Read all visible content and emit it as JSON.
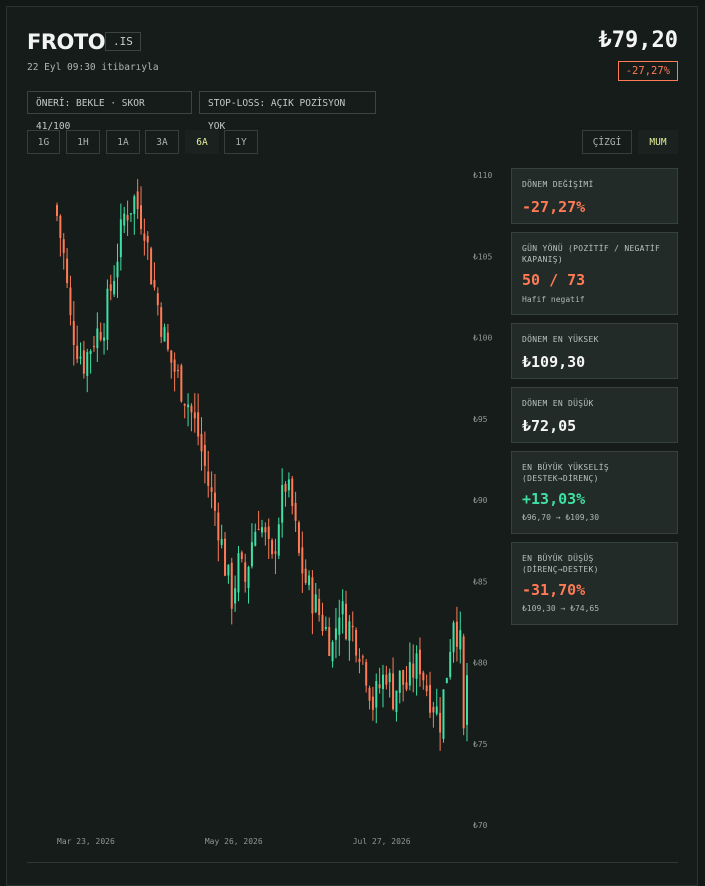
{
  "header": {
    "ticker": "FROTO",
    "suffix": ".IS",
    "as_of": "22 Eyl 09:30 itibarıyla",
    "price": "₺79,20",
    "change": "-27,27%"
  },
  "tags": {
    "recommendation": "ÖNERİ: BEKLE · SKOR 41/100",
    "stop_loss": "STOP-LOSS: AÇIK POZİSYON YOK"
  },
  "ranges": [
    "1G",
    "1H",
    "1A",
    "3A",
    "6A",
    "1Y"
  ],
  "active_range": "6A",
  "chart_modes": {
    "line": "ÇİZGİ",
    "candle": "MUM",
    "active": "MUM"
  },
  "colors": {
    "up": "#3ee0a4",
    "down": "#ff7a55",
    "accent": "#e7ef9a"
  },
  "stats": {
    "period_change": {
      "label": "DÖNEM DEĞİŞİMİ",
      "value": "-27,27%"
    },
    "day_direction": {
      "label": "GÜN YÖNÜ (POZİTİF / NEGATİF KAPANIŞ)",
      "value": "50 / 73",
      "note": "Hafif negatif"
    },
    "period_high": {
      "label": "DÖNEM EN YÜKSEK",
      "value": "₺109,30"
    },
    "period_low": {
      "label": "DÖNEM EN DÜŞÜK",
      "value": "₺72,05"
    },
    "max_rise": {
      "label": "EN BÜYÜK YÜKSELİŞ (DESTEK→DİRENÇ)",
      "value": "+13,03%",
      "range": "₺96,70 → ₺109,30"
    },
    "max_drop": {
      "label": "EN BÜYÜK DÜŞÜŞ (DİRENÇ→DESTEK)",
      "value": "-31,70%",
      "range": "₺109,30 → ₺74,65"
    }
  },
  "chart_data": {
    "type": "candlestick",
    "y_ticks": [
      "₺110",
      "₺105",
      "₺100",
      "₺95",
      "₺90",
      "₺85",
      "₺80",
      "₺75",
      "₺70"
    ],
    "y_tick_values": [
      110,
      105,
      100,
      95,
      90,
      85,
      80,
      75,
      70
    ],
    "ylim": [
      70,
      110
    ],
    "x_ticks": [
      {
        "label": "Mar 23, 2026",
        "index": 0
      },
      {
        "label": "May 26, 2026",
        "index": 44
      },
      {
        "label": "Jul 27, 2026",
        "index": 88
      }
    ],
    "candle_count": 123,
    "close_path": [
      [
        0,
        107.5
      ],
      [
        2,
        105
      ],
      [
        4,
        101
      ],
      [
        6,
        99.5
      ],
      [
        8,
        98.5
      ],
      [
        11,
        100
      ],
      [
        14,
        101
      ],
      [
        17,
        104
      ],
      [
        20,
        107.5
      ],
      [
        23,
        108.5
      ],
      [
        26,
        107
      ],
      [
        28,
        104
      ],
      [
        30,
        102
      ],
      [
        33,
        99
      ],
      [
        36,
        97.5
      ],
      [
        39,
        96
      ],
      [
        42,
        94
      ],
      [
        45,
        91
      ],
      [
        48,
        88.5
      ],
      [
        50,
        86
      ],
      [
        52,
        84
      ],
      [
        54,
        86
      ],
      [
        56,
        85
      ],
      [
        58,
        87.5
      ],
      [
        60,
        89
      ],
      [
        62,
        87.5
      ],
      [
        64,
        86
      ],
      [
        66,
        89
      ],
      [
        68,
        91
      ],
      [
        70,
        89.5
      ],
      [
        72,
        86.5
      ],
      [
        74,
        85
      ],
      [
        76,
        84
      ],
      [
        78,
        83
      ],
      [
        80,
        82
      ],
      [
        82,
        81
      ],
      [
        84,
        83.5
      ],
      [
        86,
        82.5
      ],
      [
        88,
        82
      ],
      [
        90,
        81
      ],
      [
        92,
        79.5
      ],
      [
        94,
        77.5
      ],
      [
        96,
        78.5
      ],
      [
        98,
        79.5
      ],
      [
        100,
        78
      ],
      [
        102,
        79
      ],
      [
        104,
        78.5
      ],
      [
        106,
        79.5
      ],
      [
        108,
        80
      ],
      [
        110,
        78.5
      ],
      [
        112,
        77.5
      ],
      [
        114,
        76.5
      ],
      [
        116,
        79.5
      ],
      [
        118,
        83
      ],
      [
        120,
        81
      ],
      [
        121,
        75.5
      ],
      [
        122,
        79.2
      ]
    ]
  }
}
